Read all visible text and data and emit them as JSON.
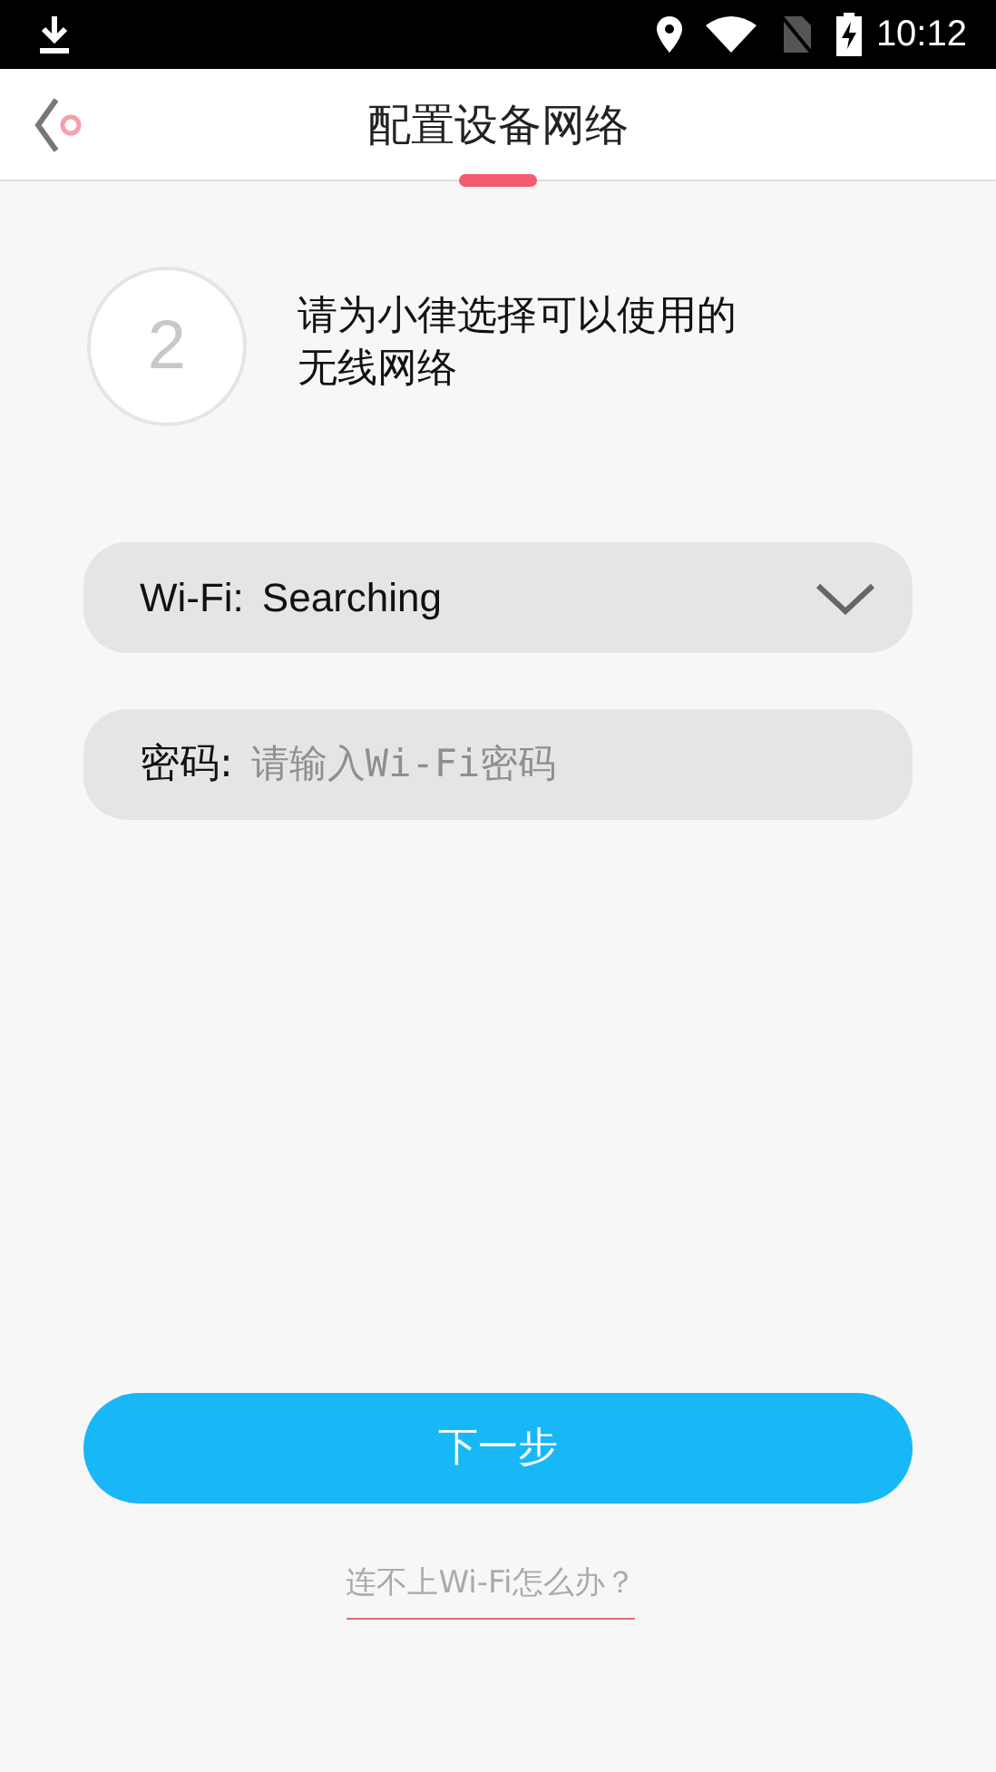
{
  "status_bar": {
    "time": "10:12"
  },
  "header": {
    "title": "配置设备网络"
  },
  "step": {
    "number": "2",
    "text": "请为小律选择可以使用的无线网络"
  },
  "wifi_select": {
    "label": "Wi-Fi:",
    "value": "Searching"
  },
  "password_field": {
    "label": "密码:",
    "placeholder": "请输入Wi-Fi密码"
  },
  "next_button": {
    "label": "下一步"
  },
  "help_link": {
    "label": "连不上Wi-Fi怎么办？"
  }
}
